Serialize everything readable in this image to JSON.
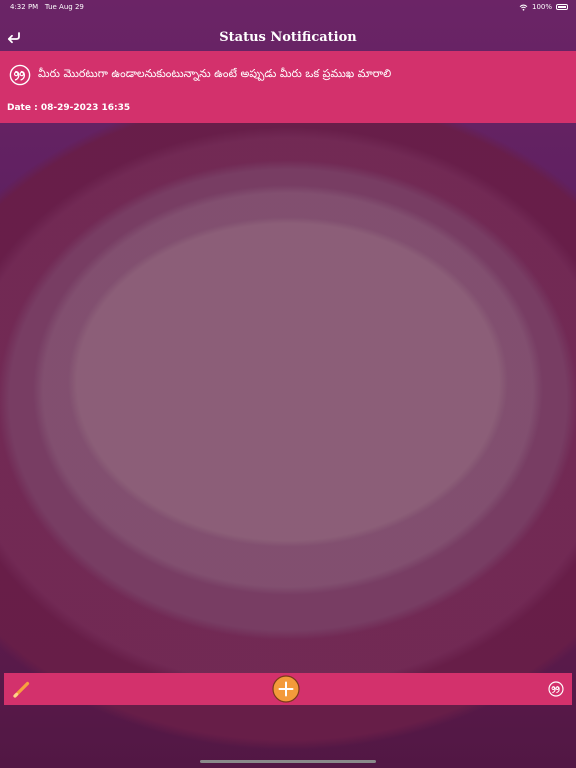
{
  "status_bar": {
    "time_date": "4:32 PM   Tue Aug 29",
    "battery_text": "100%",
    "wifi_icon": "wifi-icon",
    "battery_icon": "battery-icon"
  },
  "nav": {
    "title": "Status Notification",
    "back_icon": "back-arrow-icon"
  },
  "notification": {
    "icon": "quote-icon",
    "message": "మీరు మొరటుగా ఉండాలనుకుంటున్నాను ఉంటే అప్పుడు మీరు ఒక ప్రముఖ మారాలి",
    "date": "Date : 08-29-2023 16:35"
  },
  "bottom_bar": {
    "left_icon": "pencil-icon",
    "center_icon": "add-icon",
    "right_icon": "quote-icon"
  },
  "colors": {
    "card_background": "#d3316c",
    "add_button": "#f39a3a",
    "pencil": "#f7a23e",
    "text": "#ffffff"
  }
}
